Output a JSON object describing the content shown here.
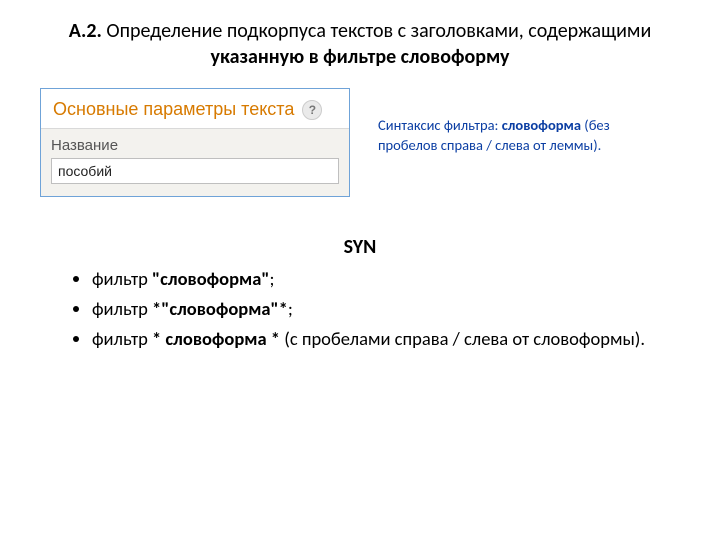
{
  "title": {
    "section": "A.2.",
    "pre": "  Определение подкорпуса текстов с заголовками, содержащими ",
    "emph": "указанную в фильтре словоформу"
  },
  "panel": {
    "header": "Основные параметры текста",
    "help": "?",
    "field_label": "Название",
    "field_value": "пособий"
  },
  "note": {
    "pre": "Синтаксис фильтра: ",
    "kw": "словоформа",
    "post": " (без пробелов справа / слева от леммы)."
  },
  "syn": {
    "heading": "SYN",
    "items": [
      {
        "pre": "фильтр ",
        "b": "\"словоформа\"",
        "post": ";"
      },
      {
        "pre": "фильтр ",
        "b": "*\"словоформа\"*",
        "post": ";"
      },
      {
        "pre": "фильтр ",
        "b": "* словоформа *",
        "post": " (с пробелами справа / слева от словоформы)."
      }
    ]
  }
}
